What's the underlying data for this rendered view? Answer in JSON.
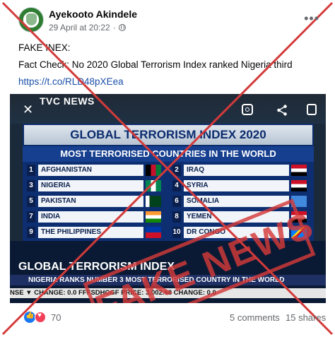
{
  "post": {
    "author": "Ayekooto Akindele",
    "date": "29 April at 20:22",
    "line1": "FAKE INEX:",
    "line2": " Fact Check:   No 2020 Global Terrorism Index ranked Nigeria third",
    "link": "https://t.co/RLD48pXEea"
  },
  "media": {
    "channel": "TVC NEWS",
    "board_title": "GLOBAL TERRORISM INDEX 2020",
    "board_subtitle": "MOST TERRORISED COUNTRIES IN THE WORLD",
    "ranks_left": [
      {
        "num": "1",
        "label": "AFGHANISTAN"
      },
      {
        "num": "3",
        "label": "NIGERIA"
      },
      {
        "num": "5",
        "label": "PAKISTAN"
      },
      {
        "num": "7",
        "label": "INDIA"
      },
      {
        "num": "9",
        "label": "THE PHILIPPINES"
      }
    ],
    "ranks_right": [
      {
        "num": "2",
        "label": "IRAQ"
      },
      {
        "num": "4",
        "label": "SYRIA"
      },
      {
        "num": "6",
        "label": "SOMALIA"
      },
      {
        "num": "8",
        "label": "YEMEN"
      },
      {
        "num": "10",
        "label": "DR CONGO"
      }
    ],
    "ticker_title": "GLOBAL TERRORISM INDEX",
    "ticker_sub": "NIGERIA RANKS NUMBER 3 MOST TERRORISED COUNTRY IN THE WORLD",
    "ticker_bottom": "NSE  ▼  CHANGE: 0.0      FFFSDHCGF  PRICE: 3,002.68      CHANGE: 0.0",
    "stamp": "FAKE NEWS"
  },
  "footer": {
    "reactions": "70",
    "comments": "5 comments",
    "shares": "15 shares"
  },
  "colors": {
    "stamp_red": "#d43a3a",
    "link_blue": "#1b4fa8",
    "like_blue": "#1877f2",
    "heart_red": "#f33e58"
  }
}
